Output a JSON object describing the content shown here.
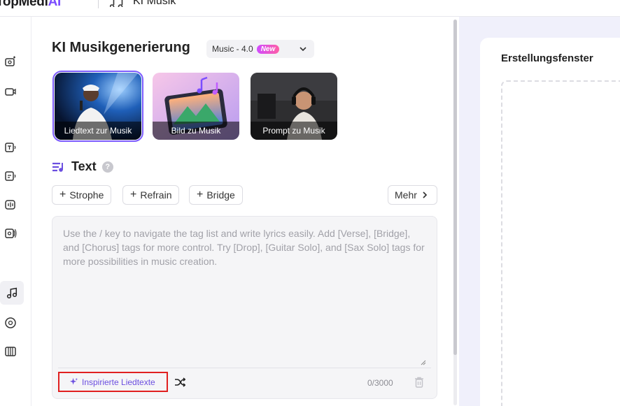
{
  "topbar": {
    "brand_prefix": "TopMedi",
    "brand_suffix": "AI",
    "title": "KI Musik"
  },
  "main": {
    "title": "KI Musikgenerierung",
    "model": {
      "label": "Music - 4.0",
      "badge": "New"
    },
    "modes": [
      {
        "label": "Liedtext zur Musik",
        "selected": true
      },
      {
        "label": "Bild zu Musik",
        "selected": false
      },
      {
        "label": "Prompt zu Musik",
        "selected": false
      }
    ],
    "text_section": {
      "heading": "Text",
      "tags": [
        "Strophe",
        "Refrain",
        "Bridge"
      ],
      "more_label": "Mehr",
      "placeholder": "Use the / key to navigate the tag list and write lyrics easily. Add [Verse], [Bridge], and [Chorus] tags for more control. Try [Drop], [Guitar Solo], and [Sax Solo] tags for more possibilities in music creation.",
      "inspire_label": "Inspirierte Liedtexte",
      "counter": "0/3000"
    }
  },
  "right": {
    "title": "Erstellungsfenster"
  },
  "colors": {
    "accent": "#7c5cff",
    "highlight": "#e02020",
    "right_bg": "#f0f0fb"
  }
}
